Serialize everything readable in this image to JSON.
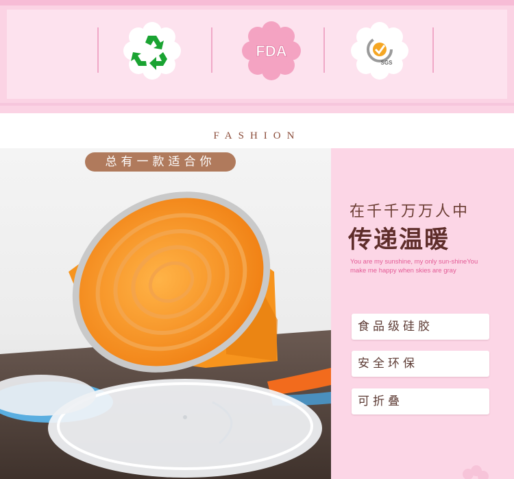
{
  "header": {
    "badges": [
      {
        "icon": "recycle-icon",
        "color": "#1aa332"
      },
      {
        "icon": "fda-icon",
        "label": "FDA",
        "color": "#f08bb2"
      },
      {
        "icon": "sgs-icon",
        "label": "SGS",
        "color": "#e9821f"
      }
    ]
  },
  "section": {
    "title": "FASHION"
  },
  "photo": {
    "slogan": "总有一款适合你"
  },
  "aside": {
    "line1": "在千千万万人中",
    "line2": "传递温暖",
    "english": "You are my sunshine, my only sun-shineYou make me happy when skies are gray",
    "features": [
      "食品级硅胶",
      "安全环保",
      "可折叠"
    ]
  },
  "colors": {
    "accent_pink": "#fbd3e4",
    "brown": "#5e2d2a",
    "orange_cup": "#f7941d"
  }
}
